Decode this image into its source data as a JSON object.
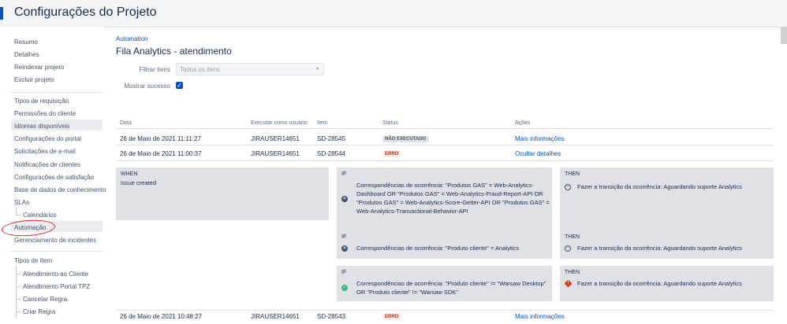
{
  "header": {
    "title": "Configurações do Projeto"
  },
  "sidebar": {
    "items": [
      {
        "label": "Resumo"
      },
      {
        "label": "Detalhes"
      },
      {
        "label": "Reindexar projeto"
      },
      {
        "label": "Excluir projeto"
      },
      {
        "label": "Tipos de requisição"
      },
      {
        "label": "Permissões do cliente"
      },
      {
        "label": "Idiomas disponíveis"
      },
      {
        "label": "Configurações do portal"
      },
      {
        "label": "Solicitações de e-mail"
      },
      {
        "label": "Notificações de clientes"
      },
      {
        "label": "Configurações de satisfação"
      },
      {
        "label": "Base de dados de conhecimento"
      },
      {
        "label": "SLAs"
      },
      {
        "label": "Calendários"
      },
      {
        "label": "Automação"
      },
      {
        "label": "Gerenciamento de incidentes"
      },
      {
        "label": "Tipos de Item"
      },
      {
        "label": "Atendimento ao Cliente"
      },
      {
        "label": "Atendimento Portal TPZ"
      },
      {
        "label": "Cancelar Regra"
      },
      {
        "label": "Criar Regra"
      }
    ]
  },
  "main": {
    "breadcrumb": "Automation",
    "title": "Fila Analytics - atendimento",
    "filter_label": "Filtrar itens",
    "filter_value": "Todos os itens",
    "success_label": "Mostrar sucesso",
    "success_checked": true,
    "columns": [
      "Data",
      "Executar como usuário",
      "Item",
      "Status",
      "Ações"
    ],
    "rows": [
      {
        "date": "26 de Maio de 2021 11:11:27",
        "user": "JIRAUSER14651",
        "item": "SD-28545",
        "status": "NÃO EXECUTADO",
        "action": "Mais informações"
      },
      {
        "date": "26 de Maio de 2021 11:00:37",
        "user": "JIRAUSER14651",
        "item": "SD-28544",
        "status": "ERRO",
        "action": "Ocultar detalhes"
      },
      {
        "date": "26 de Maio de 2021 10:48:27",
        "user": "JIRAUSER14651",
        "item": "SD-28543",
        "status": "ERRO",
        "action": "Mais informações"
      }
    ],
    "details": {
      "when_label": "WHEN",
      "when_text": "Issue created",
      "rules": [
        {
          "if_label": "IF",
          "if_text": "Correspondências de ocorrência: \"Produtos GAS\" = Web-Analytics-Dashboard OR \"Produtos GAS\" = Web-Analytics-Fraud-Report-API OR \"Produtos GAS\" = Web-Analytics-Score-Getter-API OR \"Produtos GAS\" = Web-Analytics-Transactional-Behavior-API",
          "if_icon": "x-circle-icon",
          "then_label": "THEN",
          "then_text": "Fazer a transição da ocorrência: Aguardando suporte Analytics",
          "then_icon": "minus-circle-icon"
        },
        {
          "if_label": "IF",
          "if_text": "Correspondências de ocorrência: \"Produto cliente\" = Analytics",
          "if_icon": "x-circle-icon",
          "then_label": "THEN",
          "then_text": "Fazer a transição da ocorrência: Aguardando suporte Analytics",
          "then_icon": "minus-circle-icon"
        },
        {
          "if_label": "IF",
          "if_text": "Correspondências de ocorrência: \"Produto cliente\" != \"Warsaw Desktop\" OR \"Produto cliente\" != \"Warsaw SDK\"",
          "if_icon": "check-circle-icon",
          "then_label": "THEN",
          "then_text": "Fazer a transição da ocorrência: Aguardando suporte Analytics",
          "then_icon": "warning-icon"
        }
      ]
    }
  }
}
